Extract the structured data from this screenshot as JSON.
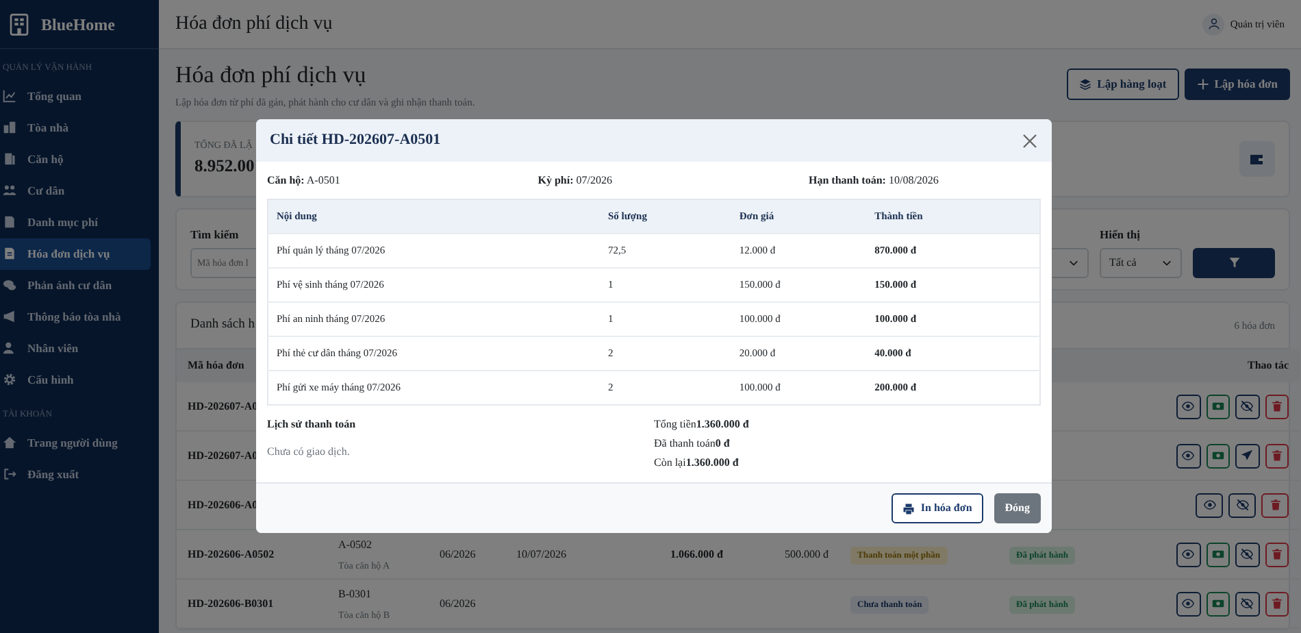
{
  "sidebar": {
    "brand": "BlueHome",
    "sections": [
      {
        "title": "QUẢN LÝ VẬN HÀNH",
        "items": [
          {
            "label": "Tổng quan",
            "selected": false
          },
          {
            "label": "Tòa nhà",
            "selected": false
          },
          {
            "label": "Căn hộ",
            "selected": false
          },
          {
            "label": "Cư dân",
            "selected": false
          },
          {
            "label": "Danh mục phí",
            "selected": false
          },
          {
            "label": "Hóa đơn dịch vụ",
            "selected": true
          },
          {
            "label": "Phản ánh cư dân",
            "selected": false
          },
          {
            "label": "Thông báo tòa nhà",
            "selected": false
          },
          {
            "label": "Nhân viên",
            "selected": false
          },
          {
            "label": "Cấu hình",
            "selected": false
          }
        ]
      },
      {
        "title": "TÀI KHOẢN",
        "items": [
          {
            "label": "Trang người dùng",
            "selected": false
          },
          {
            "label": "Đăng xuất",
            "selected": false
          }
        ]
      }
    ]
  },
  "topbar": {
    "title": "Hóa đơn phí dịch vụ",
    "user": "Quản trị viên"
  },
  "page_header": {
    "title": "Hóa đơn phí dịch vụ",
    "subtitle": "Lập hóa đơn từ phí đã gán, phát hành cho cư dân và ghi nhận thanh toán.",
    "buttons": [
      {
        "label": "Lập hàng loạt",
        "kind": "outline"
      },
      {
        "label": "Lập hóa đơn",
        "kind": "primary"
      }
    ]
  },
  "stat_card": {
    "label": "TỔNG ĐÃ LẬ",
    "value": "8.952.00"
  },
  "filters": {
    "search": {
      "label": "Tìm kiếm",
      "placeholder": "Mã hóa đơn l"
    },
    "display": {
      "label": "Hiển thị",
      "value": "Tất cả"
    }
  },
  "invoice_list": {
    "title": "Danh sách h",
    "count": "6 hóa đơn",
    "columns": {
      "code": "Mã hóa đơn",
      "actions": "Thao tác"
    },
    "rows": [
      {
        "code": "HD-202607-A0",
        "actions": [
          {
            "kind": "view"
          },
          {
            "kind": "pay"
          },
          {
            "kind": "hide"
          },
          {
            "kind": "delete"
          }
        ]
      },
      {
        "code": "HD-202607-A0",
        "actions": [
          {
            "kind": "view"
          },
          {
            "kind": "pay"
          },
          {
            "kind": "send"
          },
          {
            "kind": "delete"
          }
        ]
      },
      {
        "code": "HD-202606-A0",
        "actions": [
          {
            "kind": "view"
          },
          {
            "kind": "hide"
          },
          {
            "kind": "delete"
          }
        ]
      },
      {
        "code": "HD-202606-A0502",
        "apartment": "A-0502",
        "building": "Tòa căn hộ A",
        "period": "06/2026",
        "due": "10/07/2026",
        "total": "1.066.000 đ",
        "paid": "500.000 đ",
        "payment_status": {
          "label": "Thanh toán một phần",
          "kind": "partial"
        },
        "issue_status": {
          "label": "Đã phát hành",
          "kind": "issued"
        },
        "actions": [
          {
            "kind": "view"
          },
          {
            "kind": "pay"
          },
          {
            "kind": "hide"
          },
          {
            "kind": "delete"
          }
        ]
      },
      {
        "code": "HD-202606-B0301",
        "apartment": "B-0301",
        "building": "Tòa căn hộ B",
        "period": "06/2026",
        "payment_status": {
          "label": "Chưa thanh toán",
          "kind": "unpaid"
        },
        "issue_status": {
          "label": "Đã phát hành",
          "kind": "issued"
        },
        "actions": [
          {
            "kind": "view"
          },
          {
            "kind": "pay"
          },
          {
            "kind": "hide"
          },
          {
            "kind": "delete"
          }
        ]
      }
    ]
  },
  "dialog": {
    "title": "Chi tiết HD-202607-A0501",
    "info": [
      "**Căn hộ:** A-0501",
      "**Kỳ phí:** 07/2026",
      "**Hạn thanh toán:** 10/08/2026"
    ],
    "columns": [
      "Nội dung",
      "Số lượng",
      "Đơn giá",
      "Thành tiền"
    ],
    "items": [
      {
        "description": "Phí quản lý tháng 07/2026",
        "quantity": "72,5",
        "unit_price": "12.000 đ",
        "amount": "870.000 đ"
      },
      {
        "description": "Phí vệ sinh tháng 07/2026",
        "quantity": "1",
        "unit_price": "150.000 đ",
        "amount": "150.000 đ"
      },
      {
        "description": "Phí an ninh tháng 07/2026",
        "quantity": "1",
        "unit_price": "100.000 đ",
        "amount": "100.000 đ"
      },
      {
        "description": "Phí thẻ cư dân tháng 07/2026",
        "quantity": "2",
        "unit_price": "20.000 đ",
        "amount": "40.000 đ"
      },
      {
        "description": "Phí gửi xe máy tháng 07/2026",
        "quantity": "2",
        "unit_price": "100.000 đ",
        "amount": "200.000 đ"
      }
    ],
    "history": {
      "title": "Lịch sử thanh toán",
      "empty_text": "Chưa có giao dịch."
    },
    "totals": [
      "Tổng tiền**1.360.000 đ**",
      "Đã thanh toán**0 đ**",
      "Còn lại**1.360.000 đ**"
    ],
    "buttons": [
      {
        "label": "In hóa đơn",
        "kind": "print"
      },
      {
        "label": "Đóng",
        "kind": "close"
      }
    ]
  }
}
